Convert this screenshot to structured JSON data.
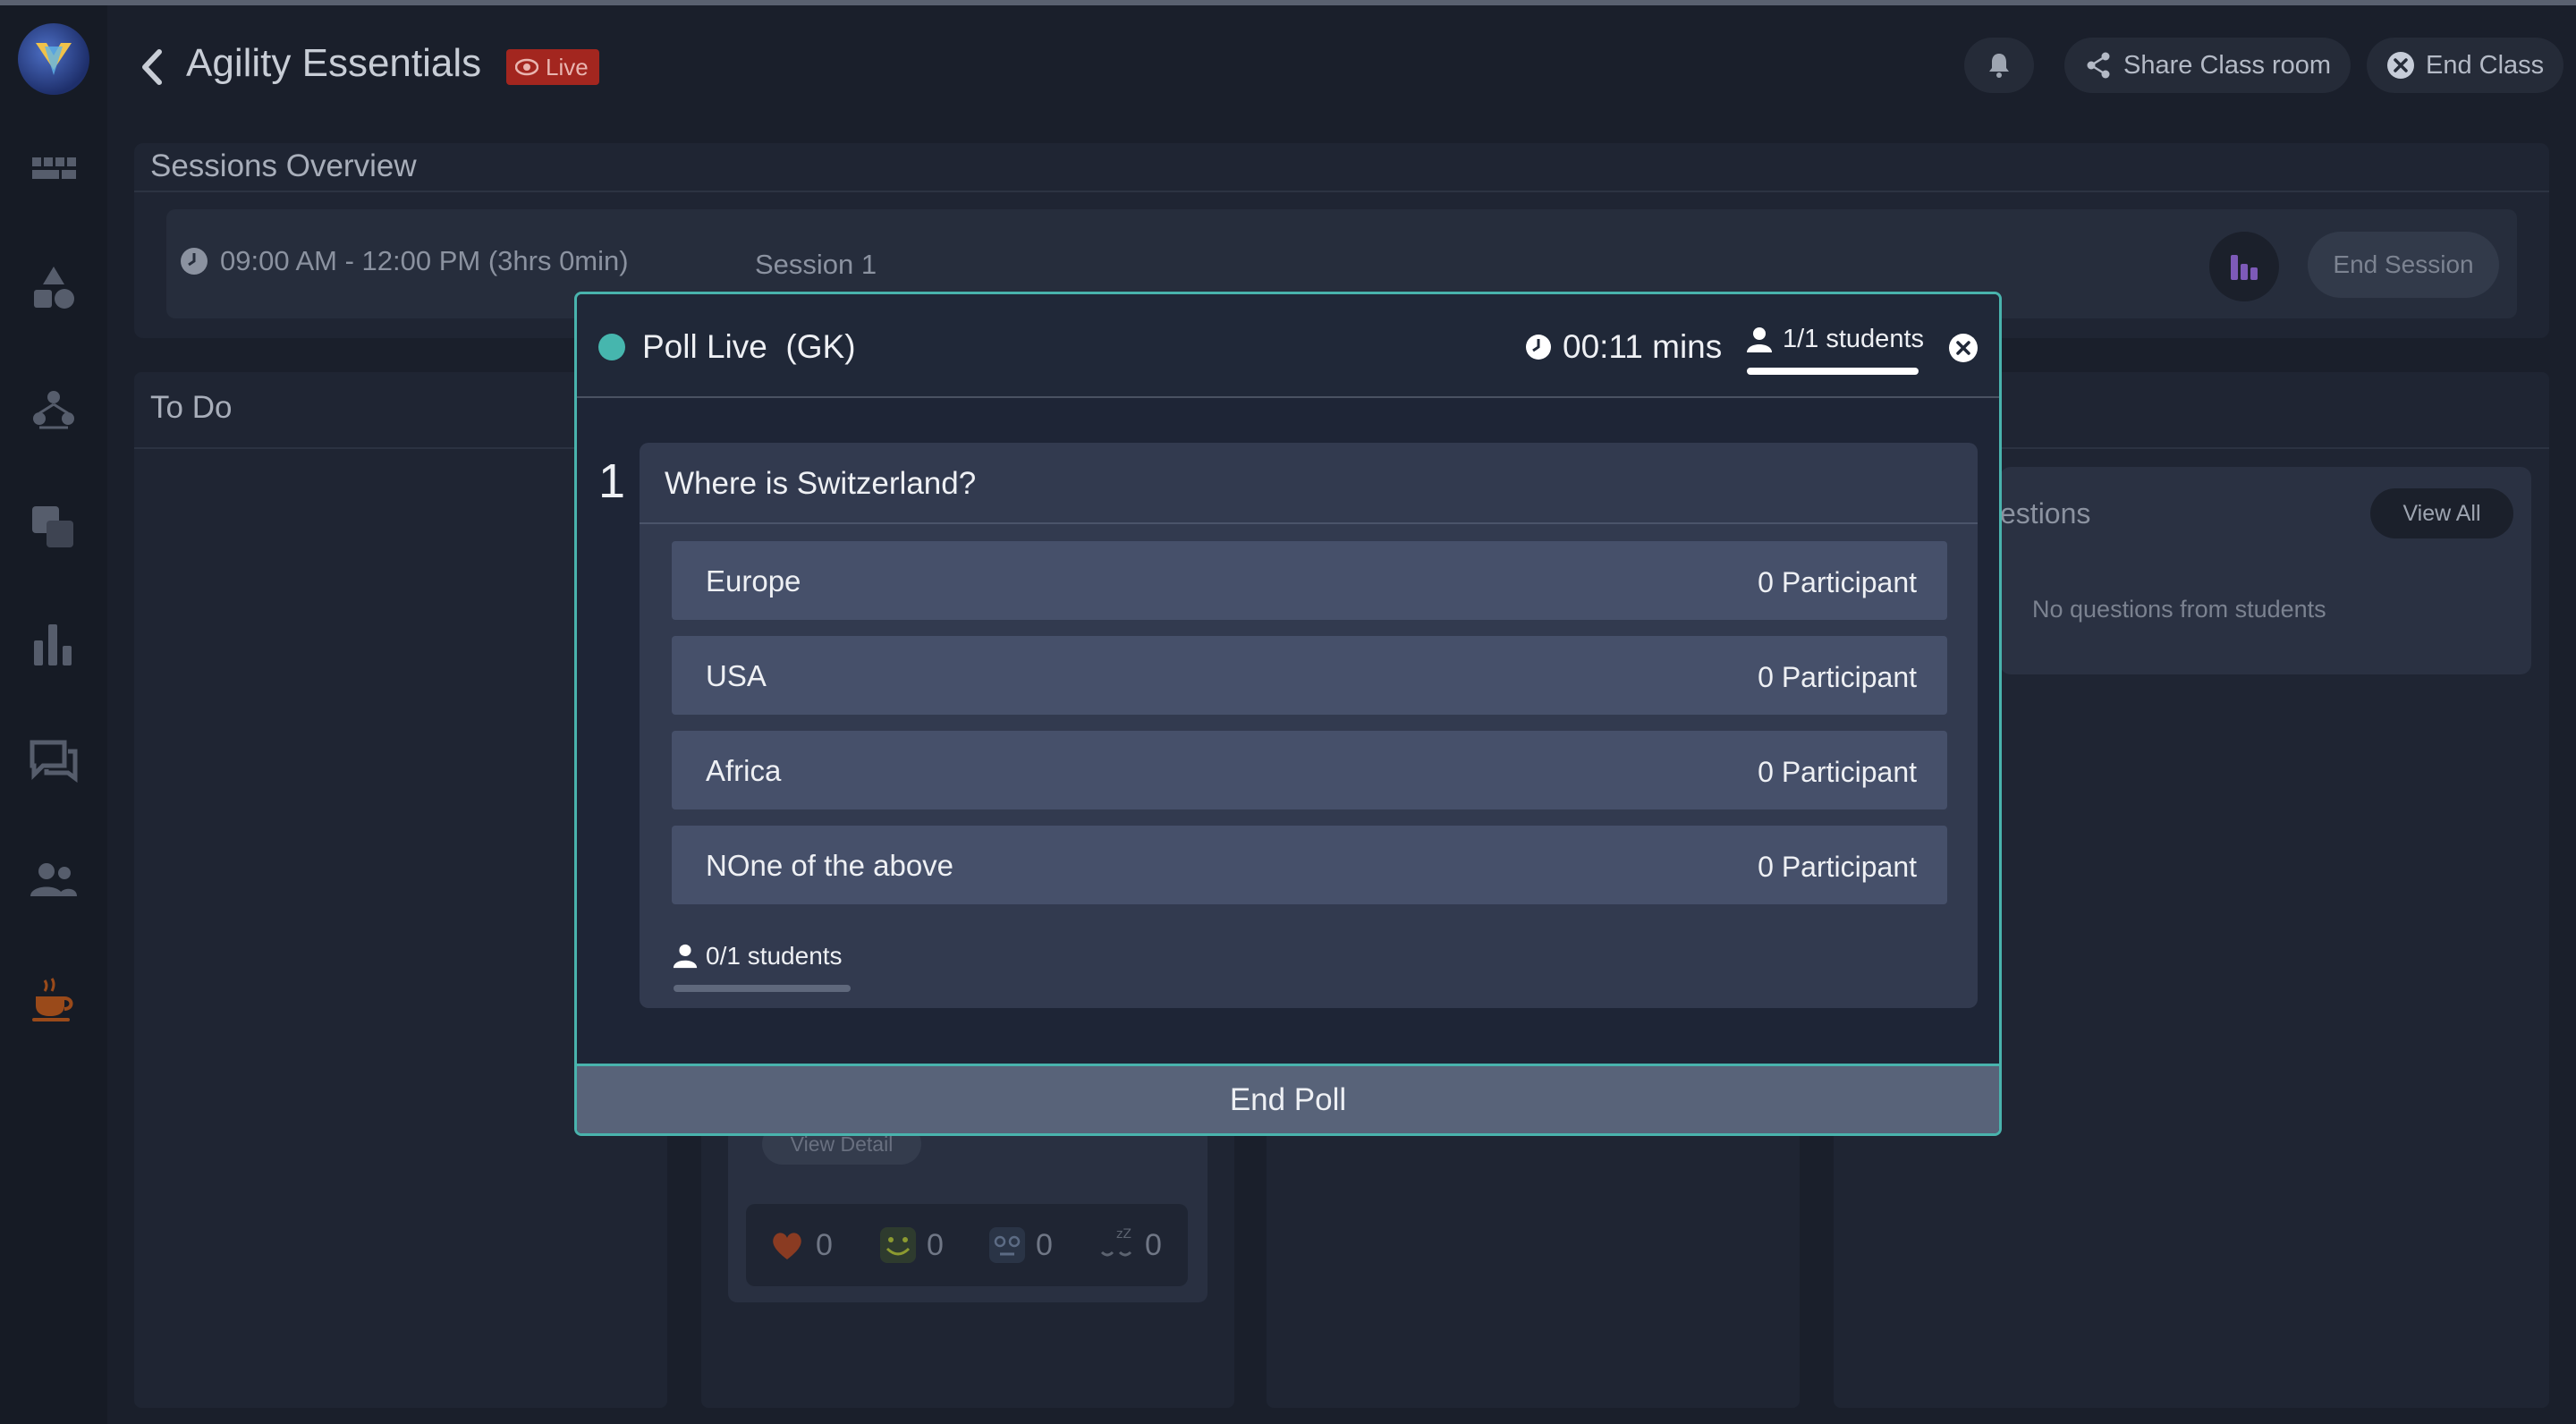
{
  "app": {
    "title": "Agility Essentials",
    "live_label": "Live"
  },
  "header": {
    "share_label": "Share Class room",
    "end_class_label": "End Class"
  },
  "sessions": {
    "title": "Sessions Overview",
    "time": "09:00 AM - 12:00 PM (3hrs 0min)",
    "name": "Session 1",
    "end_session_label": "End Session"
  },
  "todo": {
    "title": "To Do"
  },
  "questions": {
    "title_partial": "estions",
    "view_all_label": "View All",
    "empty_text": "No questions from students"
  },
  "card": {
    "view_detail_label": "View Detail",
    "reactions": [
      {
        "icon": "heart-icon",
        "count": "0"
      },
      {
        "icon": "smile-icon",
        "count": "0"
      },
      {
        "icon": "confused-icon",
        "count": "0"
      },
      {
        "icon": "sleepy-icon",
        "count": "0"
      }
    ]
  },
  "poll": {
    "title": "Poll Live  (GK)",
    "timer": "00:11 mins",
    "students": "1/1 students",
    "question_number": "1",
    "question": "Where is Switzerland?",
    "options": [
      {
        "label": "Europe",
        "count": "0 Participant"
      },
      {
        "label": "USA",
        "count": "0 Participant"
      },
      {
        "label": "Africa",
        "count": "0 Participant"
      },
      {
        "label": "NOne of the above",
        "count": "0 Participant"
      }
    ],
    "responded": "0/1 students",
    "responded_fraction": 0,
    "end_label": "End Poll"
  },
  "colors": {
    "accent": "#49b3ad",
    "live_badge": "#a3261f",
    "background": "#1a1f2b"
  }
}
